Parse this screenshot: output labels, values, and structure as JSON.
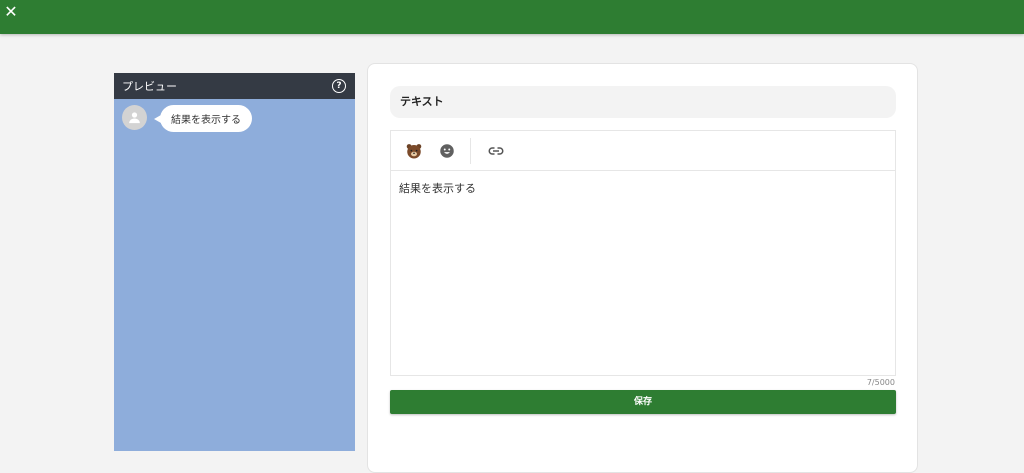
{
  "topbar": {
    "close_icon": "close-icon",
    "color": "#2e7d32"
  },
  "preview": {
    "title": "プレビュー",
    "help_icon": "help-icon",
    "background": "#8eaddb",
    "message": "結果を表示する"
  },
  "editor": {
    "header": "テキスト",
    "tools": [
      "bear-sticker-icon",
      "emoji-icon",
      "link-icon"
    ],
    "content": "結果を表示する",
    "counter": "7/5000",
    "save_label": "保存"
  }
}
